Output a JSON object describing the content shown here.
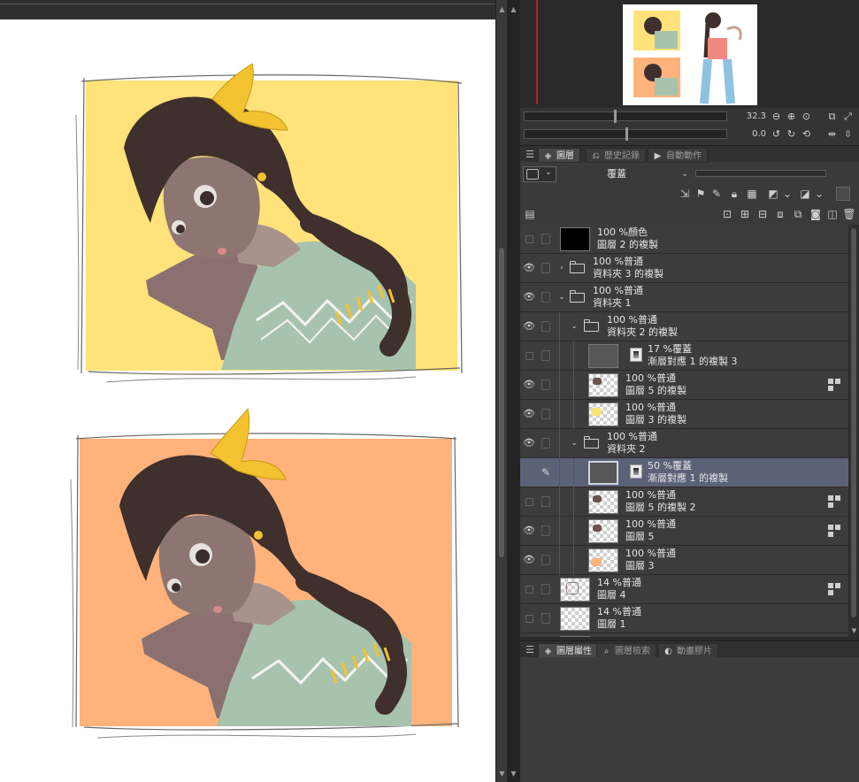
{
  "navigator": {
    "zoom_value": "32.3",
    "rotation_value": "0.0",
    "zoom_slider_fraction": 0.44,
    "rotation_slider_fraction": 0.5
  },
  "top_tabs": [
    {
      "label": "圖層",
      "icon": "layers-icon",
      "active": true
    },
    {
      "label": "歷史記錄",
      "icon": "history-icon",
      "active": false
    },
    {
      "label": "自動動作",
      "icon": "auto-action-icon",
      "active": false
    }
  ],
  "blend_mode": "覆蓋",
  "layers": [
    {
      "line1": "100 %顏色",
      "line2": "圖層 2 的複製",
      "visible": false,
      "kind": "raster",
      "thumb": "black",
      "indent": 0
    },
    {
      "line1": "100 %普通",
      "line2": "資料夾 3 的複製",
      "visible": true,
      "kind": "folder",
      "expanded": false,
      "indent": 0
    },
    {
      "line1": "100 %普通",
      "line2": "資料夾 1",
      "visible": true,
      "kind": "folder",
      "expanded": true,
      "indent": 0
    },
    {
      "line1": "100 %普通",
      "line2": "資料夾 2 的複製",
      "visible": true,
      "kind": "folder",
      "expanded": true,
      "indent": 1
    },
    {
      "line1": "17 %覆蓋",
      "line2": "漸層對應 1 的複製 3",
      "visible": false,
      "kind": "gradient-map",
      "indent": 2
    },
    {
      "line1": "100 %普通",
      "line2": "圖層 5 的複製",
      "visible": true,
      "kind": "raster",
      "thumb": "sketch",
      "indent": 2,
      "reference": true
    },
    {
      "line1": "100 %普通",
      "line2": "圖層 3 的複製",
      "visible": true,
      "kind": "raster",
      "thumb": "yellow",
      "indent": 2
    },
    {
      "line1": "100 %普通",
      "line2": "資料夾 2",
      "visible": true,
      "kind": "folder",
      "expanded": true,
      "indent": 1
    },
    {
      "line1": "50 %覆蓋",
      "line2": "漸層對應 1 的複製",
      "visible": false,
      "kind": "gradient-map",
      "indent": 2,
      "selected": true,
      "editing": true
    },
    {
      "line1": "100 %普通",
      "line2": "圖層 5 的複製 2",
      "visible": false,
      "kind": "raster",
      "thumb": "sketch",
      "indent": 2,
      "reference": true
    },
    {
      "line1": "100 %普通",
      "line2": "圖層 5",
      "visible": true,
      "kind": "raster",
      "thumb": "sketch",
      "indent": 2,
      "reference": true
    },
    {
      "line1": "100 %普通",
      "line2": "圖層 3",
      "visible": true,
      "kind": "raster",
      "thumb": "orange",
      "indent": 2
    },
    {
      "line1": "14 %普通",
      "line2": "圖層 4",
      "visible": false,
      "kind": "raster",
      "thumb": "sketch-light",
      "indent": 0,
      "reference": true
    },
    {
      "line1": "14 %普通",
      "line2": "圖層 1",
      "visible": false,
      "kind": "raster",
      "thumb": "empty",
      "indent": 0
    },
    {
      "line1": "",
      "line2": "",
      "visible": true,
      "kind": "paper",
      "thumb": "white",
      "indent": 0
    }
  ],
  "bottom_tabs": [
    {
      "label": "圖層屬性",
      "icon": "layer-property-icon",
      "active": true
    },
    {
      "label": "圖層檢索",
      "icon": "layer-search-icon",
      "active": false
    },
    {
      "label": "動畫膠片",
      "icon": "animation-cels-icon",
      "active": false
    }
  ],
  "colors": {
    "panel_bg": "#3c3c3c",
    "selected_row": "#5b6278",
    "art_yellow": "#ffe27a",
    "art_orange": "#ffb27a",
    "hair": "#3f2f2d",
    "sweater": "#a7c3ad",
    "ornament_gold": "#f2c230"
  }
}
